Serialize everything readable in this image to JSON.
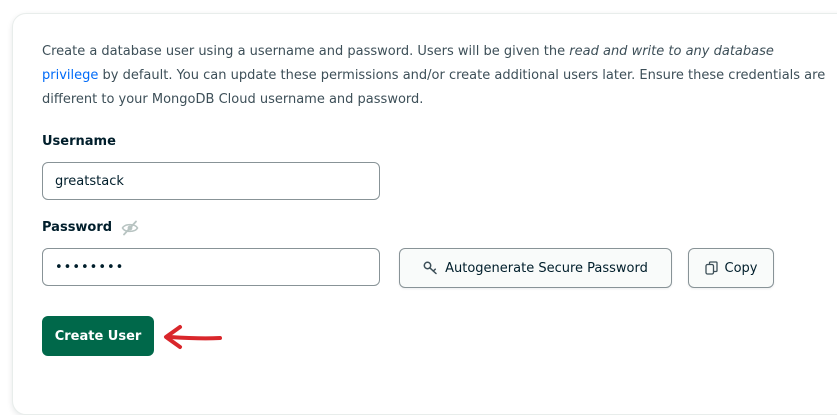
{
  "intro": {
    "part1": "Create a database user using a username and password. Users will be given the ",
    "privilege_italic": "read and write to any database",
    "privilege_link": "privilege",
    "part2": " by default. You can update these permissions and/or create additional users later. Ensure these credentials are different to your MongoDB Cloud username and password."
  },
  "username": {
    "label": "Username",
    "value": "greatstack"
  },
  "password": {
    "label": "Password",
    "value": "••••••••",
    "visibility_icon": "eye-off-icon"
  },
  "buttons": {
    "autogenerate_label": "Autogenerate Secure Password",
    "autogenerate_icon": "key-icon",
    "copy_label": "Copy",
    "copy_icon": "copy-icon",
    "create_label": "Create User"
  },
  "annotation": {
    "arrow_color": "#d9262b"
  },
  "colors": {
    "primary_button": "#00684a",
    "link": "#016bf8"
  }
}
